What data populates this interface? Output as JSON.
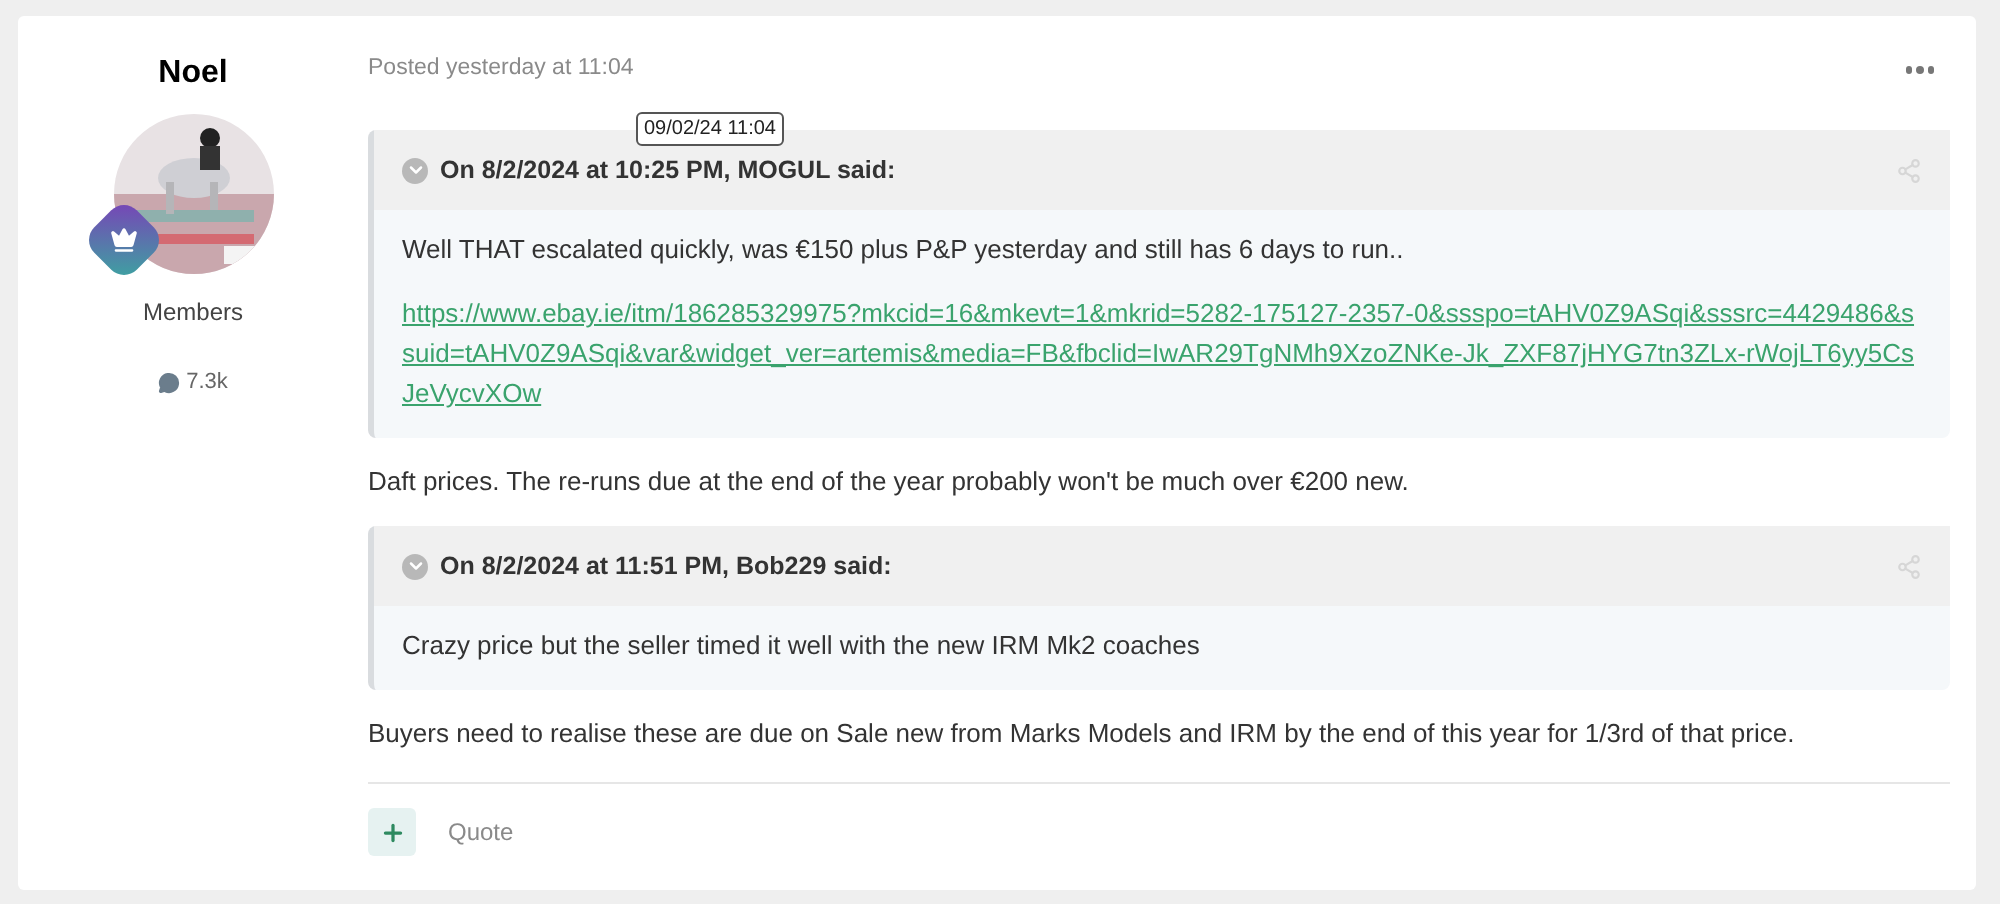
{
  "author": {
    "name": "Noel",
    "role": "Members",
    "post_count": "7.3k"
  },
  "post": {
    "posted": "Posted yesterday at 11:04",
    "tooltip": "09/02/24 11:04",
    "blocks": [
      {
        "kind": "quote",
        "header": "On 8/2/2024 at 10:25 PM, MOGUL said:",
        "paragraphs": [
          {
            "kind": "text",
            "text": "Well THAT escalated quickly, was €150 plus P&P yesterday and still has 6 days to run.."
          },
          {
            "kind": "link",
            "text": "https://www.ebay.ie/itm/186285329975?mkcid=16&mkevt=1&mkrid=5282-175127-2357-0&ssspo=tAHV0Z9ASqi&sssrc=4429486&ssuid=tAHV0Z9ASqi&var&widget_ver=artemis&media=FB&fbclid=IwAR29TgNMh9XzoZNKe-Jk_ZXF87jHYG7tn3ZLx-rWojLT6yy5CsJeVycvXOw"
          }
        ]
      },
      {
        "kind": "text",
        "text": "Daft prices. The re-runs due at the end of the year probably won't be much over €200 new."
      },
      {
        "kind": "quote",
        "header": "On 8/2/2024 at 11:51 PM, Bob229 said:",
        "paragraphs": [
          {
            "kind": "text",
            "text": "Crazy price but the seller timed it well with the new IRM Mk2 coaches"
          }
        ]
      },
      {
        "kind": "text",
        "text": "Buyers need to realise these are due on Sale new from Marks Models and IRM by the end of this year for 1/3rd of that price."
      }
    ]
  },
  "actions": {
    "quote_label": "Quote"
  }
}
